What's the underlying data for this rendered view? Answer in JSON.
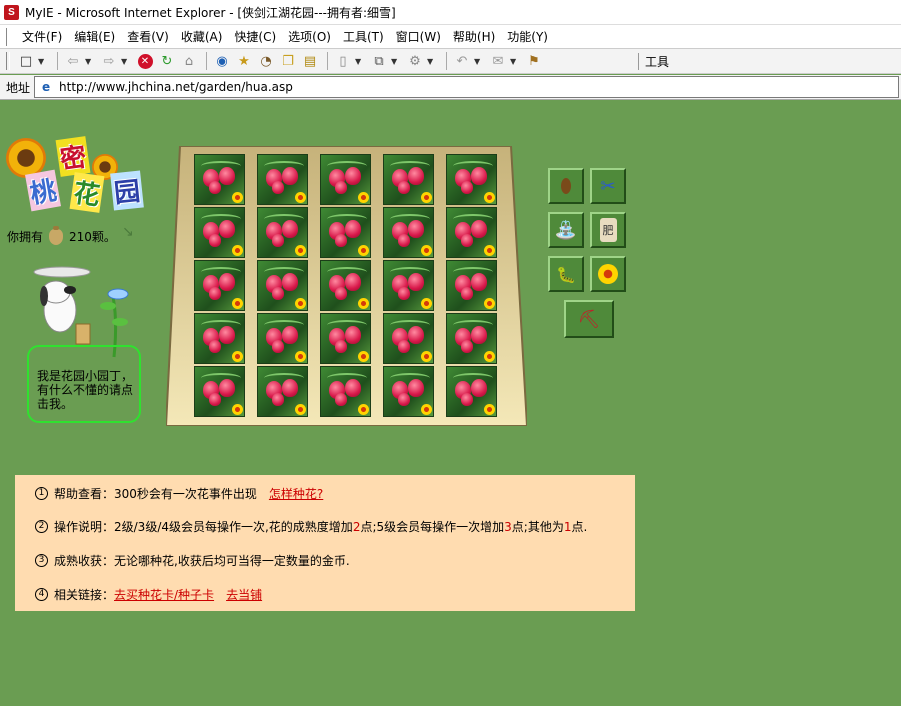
{
  "window": {
    "title": "MyIE - Microsoft Internet Explorer - [侠剑江湖花园---拥有者:细雪]",
    "app_icon": "S"
  },
  "menu": [
    "文件(F)",
    "编辑(E)",
    "查看(V)",
    "收藏(A)",
    "快捷(C)",
    "选项(O)",
    "工具(T)",
    "窗口(W)",
    "帮助(H)",
    "功能(Y)"
  ],
  "toolbar": {
    "right_label": "工具"
  },
  "address": {
    "label": "地址",
    "url": "http://www.jhchina.net/garden/hua.asp"
  },
  "garden": {
    "logo_chars": [
      "密",
      "桃",
      "花",
      "园"
    ],
    "owned_prefix": "你拥有",
    "owned_amount": "210颗。",
    "gardener_bubble": "我是花园小园丁，有什么不懂的请点击我。",
    "flower_tiles_rows": 5,
    "flower_tiles_cols": 5,
    "tool_labels": [
      "肥"
    ]
  },
  "info": {
    "rows": [
      {
        "num": "1",
        "text": "帮助查看：300秒会有一次花事件出现",
        "link": "怎样种花?"
      },
      {
        "num": "2",
        "text_parts": [
          "操作说明：2级/3级/4级会员每操作一次,花的成熟度增加",
          "2",
          "点;5级会员每操作一次增加",
          "3",
          "点;其他为",
          "1",
          "点."
        ]
      },
      {
        "num": "3",
        "text": "成熟收获：无论哪种花,收获后均可当得一定数量的金币."
      },
      {
        "num": "4",
        "text": "相关链接：",
        "links": [
          "去买种花卡/种子卡",
          "去当铺"
        ]
      }
    ]
  },
  "colors": {
    "page_bg": "#6a9d52",
    "info_bg": "#ffdcb0",
    "link": "#cc0000",
    "bubble_border": "#2fe22f"
  }
}
